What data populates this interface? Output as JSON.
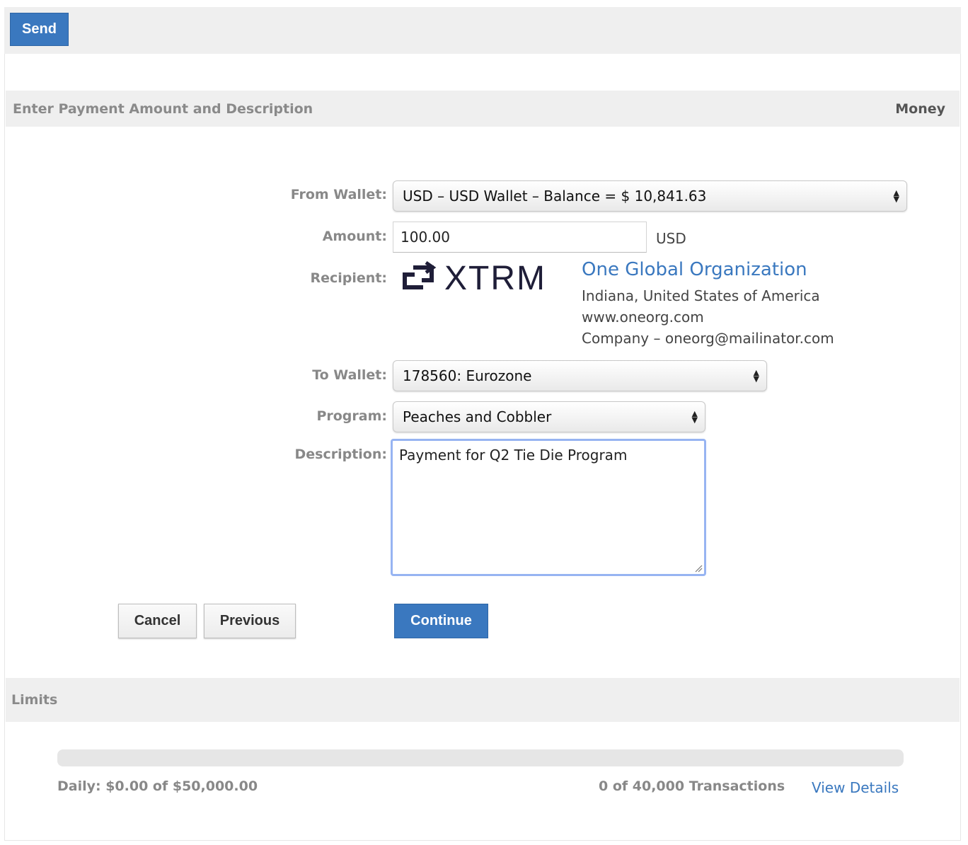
{
  "header": {
    "send_label": "Send"
  },
  "section": {
    "title": "Enter Payment Amount and Description",
    "right_label": "Money"
  },
  "form": {
    "from_wallet_label": "From Wallet:",
    "from_wallet_value": "USD – USD Wallet – Balance = $ 10,841.63",
    "amount_label": "Amount:",
    "amount_value": "100.00",
    "amount_currency": "USD",
    "recipient_label": "Recipient:",
    "to_wallet_label": "To Wallet:",
    "to_wallet_value": "178560: Eurozone",
    "program_label": "Program:",
    "program_value": "Peaches and Cobbler",
    "description_label": "Description:",
    "description_value": "Payment for Q2 Tie Die Program"
  },
  "recipient": {
    "logo_text": "XTRM",
    "name": "One Global Organization",
    "location": "Indiana, United States of America",
    "website": "www.oneorg.com",
    "contact": "Company – oneorg@mailinator.com"
  },
  "buttons": {
    "cancel": "Cancel",
    "previous": "Previous",
    "continue": "Continue"
  },
  "limits": {
    "title": "Limits",
    "daily_text": "Daily: $0.00 of $50,000.00",
    "daily_used_fraction": 0,
    "transactions_text": "0 of 40,000 Transactions",
    "view_details": "View Details"
  },
  "colors": {
    "accent": "#3a78bf",
    "section_bg": "#efefef",
    "label": "#888888"
  },
  "icons": {
    "logo": "xtrm-logo-icon",
    "select_arrows": "up-down-arrows-icon",
    "resize": "resize-grip-icon"
  }
}
